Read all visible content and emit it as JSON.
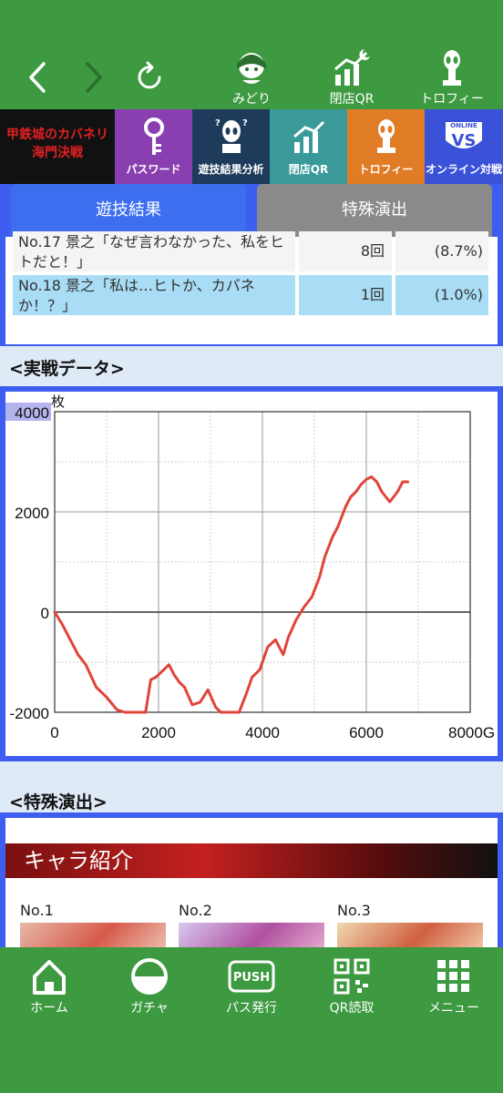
{
  "top_nav": {
    "items": [
      {
        "label": "みどり",
        "icon": "character-icon"
      },
      {
        "label": "閉店QR",
        "icon": "chart-up-icon"
      },
      {
        "label": "トロフィー",
        "icon": "trophy-alien-icon"
      }
    ]
  },
  "shortcuts": [
    {
      "label": "",
      "logo_text": "甲鉄城のカバネリ 海門決戦",
      "color": "#111111"
    },
    {
      "label": "パスワード",
      "color": "#8a3fb0"
    },
    {
      "label": "遊技結果分析",
      "color": "#1e3b5c"
    },
    {
      "label": "閉店QR",
      "color": "#3a9a9a"
    },
    {
      "label": "トロフィー",
      "color": "#e07b26"
    },
    {
      "label": "オンライン対戦",
      "vs_text": "VS",
      "online_text": "ONLINE",
      "color": "#3a52d8"
    }
  ],
  "tabs": [
    {
      "label": "遊技結果",
      "active": true
    },
    {
      "label": "特殊演出",
      "active": false
    }
  ],
  "results": [
    {
      "name": "No.17 景之「なぜ言わなかった、私をヒトだと！」",
      "count": "8回",
      "percent": "(8.7%)",
      "highlight": false
    },
    {
      "name": "No.18 景之「私は…ヒトか、カバネか！？」",
      "count": "1回",
      "percent": "(1.0%)",
      "highlight": true
    }
  ],
  "data_section_title": "<実戦データ>",
  "special_section_title": "<特殊演出>",
  "chart_data": {
    "type": "line",
    "ylabel": "枚",
    "xlabel": "G",
    "xlim": [
      0,
      8000
    ],
    "ylim": [
      -2000,
      4000
    ],
    "x_ticks": [
      "0",
      "2000",
      "4000",
      "6000",
      "8000G"
    ],
    "y_ticks": [
      "4000",
      "2000",
      "0",
      "-2000"
    ],
    "grid": true,
    "color": "#e0443a",
    "series": [
      {
        "x": [
          0,
          150,
          300,
          450,
          600,
          800,
          1000,
          1200,
          1350,
          1450,
          1600,
          1750,
          1850,
          1950,
          2100,
          2200,
          2300,
          2400,
          2500,
          2650,
          2800,
          2950,
          3100,
          3200,
          3300,
          3400,
          3550,
          3700,
          3800,
          3950,
          4100,
          4250,
          4400,
          4500,
          4650,
          4800,
          4950,
          5100,
          5200,
          5350,
          5450,
          5600,
          5700,
          5800,
          5900,
          6000,
          6100,
          6200,
          6300,
          6450,
          6600,
          6700,
          6800
        ],
        "y": [
          0,
          -250,
          -550,
          -850,
          -1050,
          -1500,
          -1700,
          -1950,
          -2050,
          -2050,
          -2050,
          -2000,
          -1350,
          -1300,
          -1150,
          -1050,
          -1250,
          -1400,
          -1500,
          -1850,
          -1800,
          -1550,
          -1900,
          -2050,
          -2050,
          -2050,
          -2050,
          -1600,
          -1300,
          -1150,
          -700,
          -550,
          -850,
          -500,
          -150,
          100,
          300,
          700,
          1100,
          1500,
          1700,
          2100,
          2300,
          2400,
          2550,
          2650,
          2700,
          2600,
          2400,
          2200,
          2400,
          2600,
          2600
        ]
      }
    ]
  },
  "chara_header": "キャラ紹介",
  "chara_cards": [
    {
      "label": "No.1"
    },
    {
      "label": "No.2"
    },
    {
      "label": "No.3"
    }
  ],
  "bottom_nav": [
    {
      "label": "ホーム",
      "icon": "home-icon"
    },
    {
      "label": "ガチャ",
      "icon": "gacha-icon"
    },
    {
      "label": "パス発行",
      "icon": "push-icon",
      "badge": "PUSH"
    },
    {
      "label": "QR読取",
      "icon": "qr-code-icon"
    },
    {
      "label": "メニュー",
      "icon": "grid-menu-icon"
    }
  ]
}
